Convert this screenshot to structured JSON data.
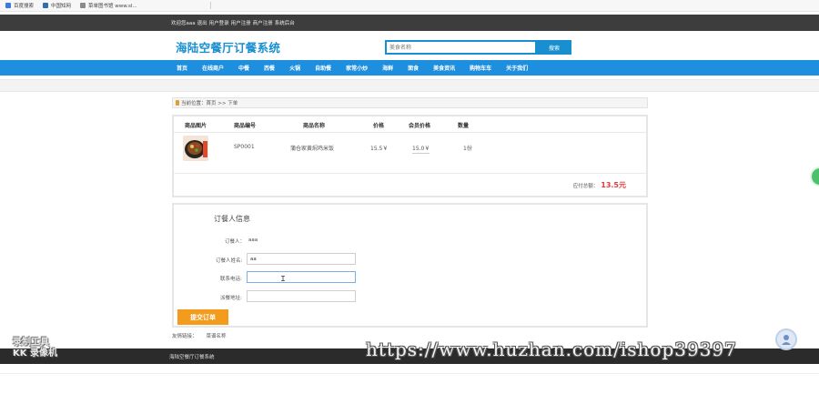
{
  "bookmarks": [
    {
      "label": "百度搜索",
      "color": "#3b7be0"
    },
    {
      "label": "中国知网",
      "color": "#2f6fb0"
    },
    {
      "label": "菜单图书馆 www.sl...",
      "color": "#8a8a8a"
    }
  ],
  "topbar": {
    "items": [
      "欢迎您aaa",
      "退出",
      "用户登录",
      "用户注册",
      "商户注册",
      "系统后台"
    ]
  },
  "header": {
    "logo": "海陆空餐厅订餐系统",
    "search_placeholder": "美食名称",
    "search_button": "搜索"
  },
  "nav": {
    "items": [
      "首页",
      "在线商户",
      "中餐",
      "西餐",
      "火锅",
      "自助餐",
      "家常小炒",
      "海鲜",
      "面食",
      "美食资讯",
      "购物车车",
      "关于我们"
    ]
  },
  "breadcrumb": {
    "label": "当前位置：首页 >> 下单"
  },
  "cart": {
    "headers": [
      "商品图片",
      "商品编号",
      "商品名称",
      "价格",
      "会员价格",
      "数量"
    ],
    "row": {
      "code": "SP0001",
      "name": "蒲仓家黄焖鸡米饭",
      "price": "15.5￥",
      "member_price": "15.0￥",
      "quantity": "1份"
    },
    "total_label": "应付总额：",
    "total_value": "13.5元"
  },
  "order": {
    "title": "订餐人信息",
    "orderer_label": "订餐人：",
    "orderer_value": "aaa",
    "name_label": "订餐人姓名:",
    "name_value": "aa",
    "phone_label": "联系电话:",
    "phone_value": "",
    "address_label": "派餐地址:",
    "address_value": "",
    "submit": "提交订单"
  },
  "links": {
    "label": "友情链接：",
    "item": "菜谱名称"
  },
  "footer": {
    "text": "海陆空餐厅订餐系统"
  },
  "watermark": {
    "left_line1": "录制工具",
    "left_line2": "KK 录像机",
    "url": "https://www.huzhan.com/ishop39397"
  }
}
